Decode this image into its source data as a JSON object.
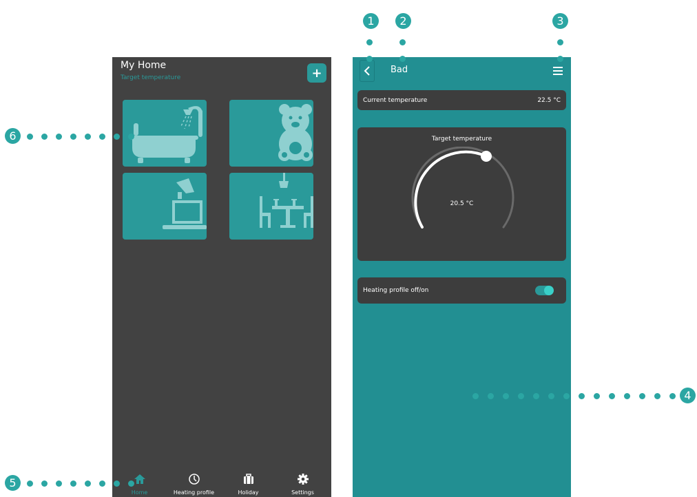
{
  "left_screen": {
    "title": "My Home",
    "subtitle": "Target temperature",
    "add_label": "+",
    "tiles": [
      {
        "icon": "bathtub-shower-icon"
      },
      {
        "icon": "teddy-bear-icon"
      },
      {
        "icon": "laptop-lamp-icon"
      },
      {
        "icon": "dining-table-icon"
      }
    ],
    "nav": [
      {
        "label": "Home",
        "icon": "home-icon",
        "active": true
      },
      {
        "label": "Heating profile",
        "icon": "clock-icon",
        "active": false
      },
      {
        "label": "Holiday",
        "icon": "suitcase-icon",
        "active": false
      },
      {
        "label": "Settings",
        "icon": "gear-icon",
        "active": false
      }
    ]
  },
  "right_screen": {
    "title": "Bad",
    "current_label": "Current temperature",
    "current_value": "22.5 °C",
    "target_label": "Target temperature",
    "target_value": "20.5 °C",
    "heating_label": "Heating profile off/on",
    "heating_on": true
  },
  "callouts": [
    "1",
    "2",
    "3",
    "4",
    "5",
    "6"
  ],
  "colors": {
    "accent": "#2a9a9a",
    "right_background": "#228f92",
    "dark_panel": "#424242",
    "card": "#3d3d3d"
  }
}
